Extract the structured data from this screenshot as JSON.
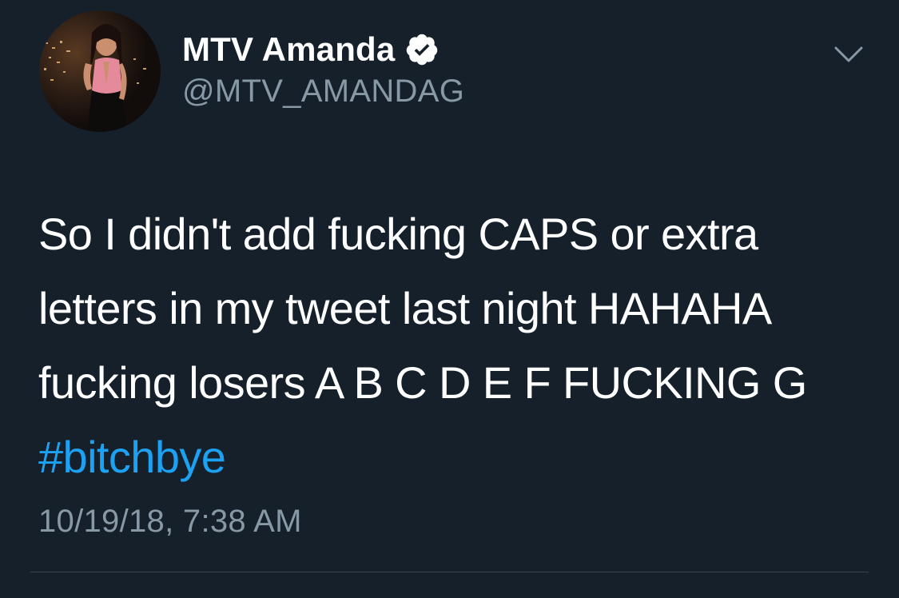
{
  "tweet": {
    "display_name": "MTV Amanda",
    "handle": "@MTV_AMANDAG",
    "verified": true,
    "text_lines": [
      "So I didn't add fucking CAPS or extra",
      "letters in my tweet last night HAHAHA",
      "fucking losers A B C D E F FUCKING G"
    ],
    "hashtag": "#bitchbye",
    "timestamp": "10/19/18, 7:38 AM"
  },
  "icons": {
    "verified": "verified-badge-icon",
    "menu": "chevron-down-icon"
  },
  "colors": {
    "background": "#15202b",
    "text": "#ffffff",
    "secondary_text": "#8899a6",
    "hashtag": "#1da1f2",
    "divider": "#38444d"
  }
}
